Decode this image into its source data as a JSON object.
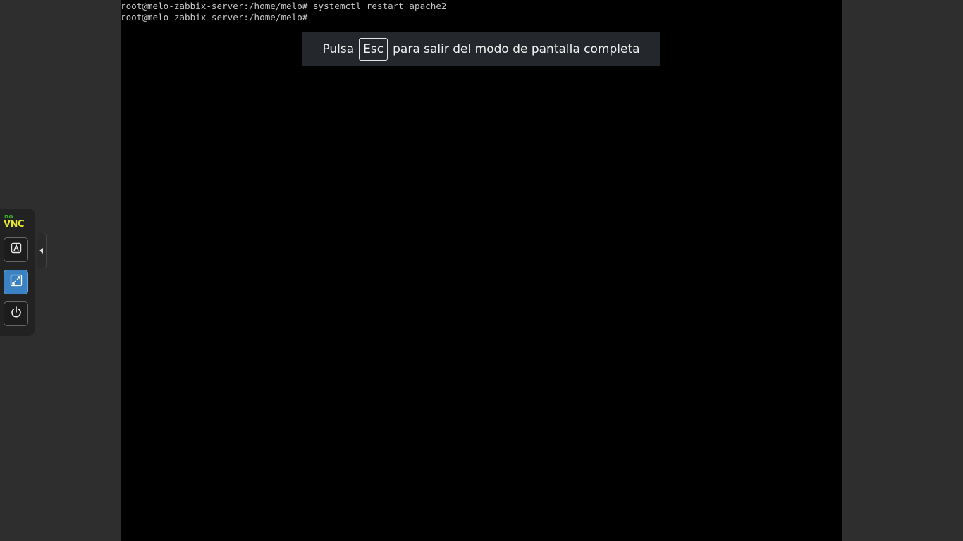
{
  "terminal": {
    "lines": [
      "root@melo-zabbix-server:/home/melo# systemctl restart apache2",
      "root@melo-zabbix-server:/home/melo#"
    ]
  },
  "fullscreen_notice": {
    "prefix": "Pulsa",
    "key": "Esc",
    "suffix": "para salir del modo de pantalla completa"
  },
  "control_bar": {
    "logo_no": "no",
    "logo_vnc": "VNC",
    "buttons": [
      {
        "name": "keyboard",
        "icon": "keyboard-icon"
      },
      {
        "name": "fullscreen",
        "icon": "fullscreen-icon",
        "active": true
      },
      {
        "name": "power",
        "icon": "power-icon"
      }
    ],
    "handle_icon": "arrow-left-icon"
  },
  "colors": {
    "background": "#2e2e2e",
    "screen": "#000000",
    "banner": "#24272b",
    "logo_green": "#2eb82e",
    "logo_yellow": "#e5e52c",
    "active_button": "#3b82c4"
  }
}
